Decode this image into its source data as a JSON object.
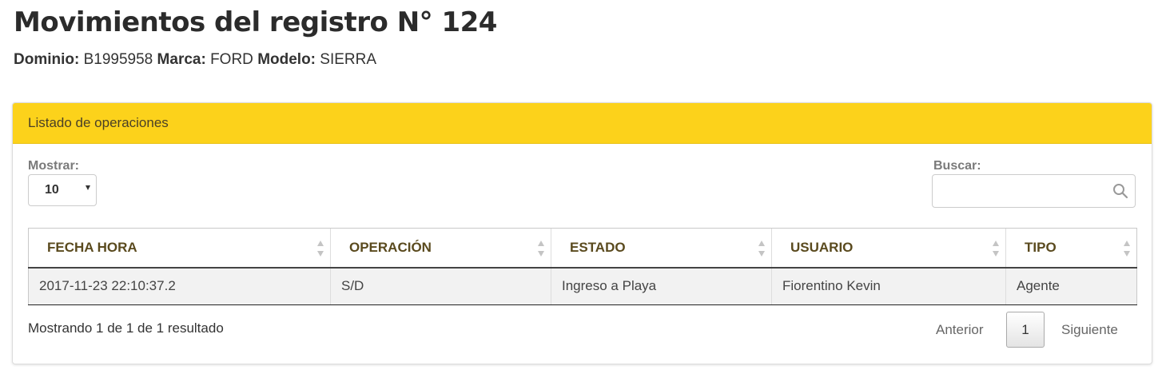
{
  "page": {
    "title": "Movimientos del registro N° 124",
    "vehicle": {
      "dominio_label": "Dominio:",
      "dominio": "B1995958",
      "marca_label": "Marca:",
      "marca": "FORD",
      "modelo_label": "Modelo:",
      "modelo": "SIERRA"
    }
  },
  "panel": {
    "heading": "Listado de operaciones",
    "length": {
      "label": "Mostrar:",
      "selected": "10"
    },
    "search": {
      "label": "Buscar:",
      "value": "",
      "placeholder": ""
    },
    "table": {
      "columns": [
        "FECHA HORA",
        "OPERACIÓN",
        "ESTADO",
        "USUARIO",
        "TIPO"
      ],
      "rows": [
        [
          "2017-11-23 22:10:37.2",
          "S/D",
          "Ingreso a Playa",
          "Fiorentino Kevin",
          "Agente"
        ]
      ]
    },
    "info": "Mostrando 1 de 1 de 1 resultado",
    "pagination": {
      "previous": "Anterior",
      "current": "1",
      "next": "Siguiente"
    }
  },
  "colors": {
    "heading_bg": "#fcd21b",
    "header_text": "#5a4a1e",
    "row_bg": "#f2f2f2"
  },
  "icons": [
    "search-icon",
    "sort-icon",
    "dropdown-arrow-icon"
  ]
}
